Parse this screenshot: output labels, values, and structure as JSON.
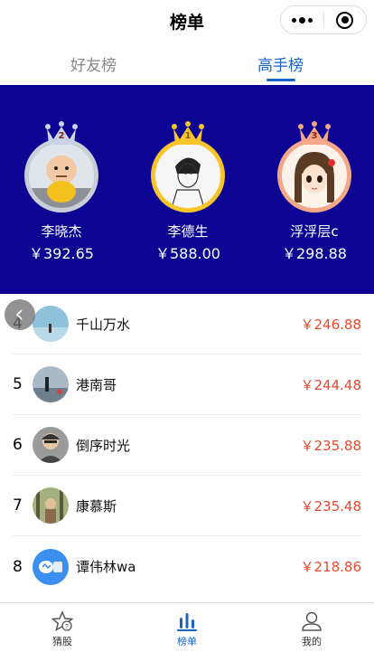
{
  "nav": {
    "title": "榜单"
  },
  "tabs": [
    {
      "label": "好友榜",
      "active": false
    },
    {
      "label": "高手榜",
      "active": true
    }
  ],
  "podium": [
    {
      "rank": "2",
      "name": "李晓杰",
      "amount": "￥392.65",
      "ring_color": "#c9ced8",
      "crown_color": "#c9d3e8",
      "avatar": "toy-figure"
    },
    {
      "rank": "1",
      "name": "李德生",
      "amount": "￥588.00",
      "ring_color": "#f5c52a",
      "crown_color": "#f5c52a",
      "avatar": "sketch-man"
    },
    {
      "rank": "3",
      "name": "浮浮层c",
      "amount": "￥298.88",
      "ring_color": "#f3a688",
      "crown_color": "#f3a688",
      "avatar": "anime-girl"
    }
  ],
  "list": [
    {
      "rank": "4",
      "name": "千山万水",
      "amount": "￥246.88",
      "avatar_color": "#7fb3cf"
    },
    {
      "rank": "5",
      "name": "港南哥",
      "amount": "￥244.48",
      "avatar_color": "#8aa0b8"
    },
    {
      "rank": "6",
      "name": "倒序时光",
      "amount": "￥235.88",
      "avatar_color": "#6a6a6a"
    },
    {
      "rank": "7",
      "name": "康慕斯",
      "amount": "￥235.48",
      "avatar_color": "#7a8a5a"
    },
    {
      "rank": "8",
      "name": "谭伟林wa",
      "amount": "￥218.86",
      "avatar_color": "#3b8ff0"
    }
  ],
  "tabbar": [
    {
      "label": "猜股",
      "icon": "star-question-icon",
      "active": false
    },
    {
      "label": "榜单",
      "icon": "bar-chart-icon",
      "active": true
    },
    {
      "label": "我的",
      "icon": "user-icon",
      "active": false
    }
  ],
  "colors": {
    "accent": "#1a63c9",
    "podium_bg": "#0d0493",
    "amount_red": "#e8492e"
  }
}
